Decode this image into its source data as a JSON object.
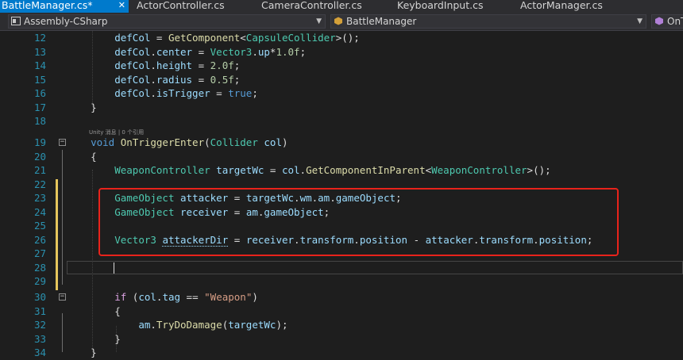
{
  "tabs": [
    {
      "label": "BattleManager.cs*",
      "close": "✕",
      "active": true
    },
    {
      "label": "ActorController.cs",
      "active": false
    },
    {
      "label": "CameraController.cs",
      "active": false
    },
    {
      "label": "KeyboardInput.cs",
      "active": false
    },
    {
      "label": "ActorManager.cs",
      "active": false
    }
  ],
  "navbar": {
    "project": "Assembly-CSharp",
    "class_name": "BattleManager",
    "member": "OnTrig"
  },
  "codelens": "Unity 消息 | 0 个引用",
  "line_numbers": [
    "12",
    "13",
    "14",
    "15",
    "16",
    "17",
    "18",
    "19",
    "20",
    "21",
    "22",
    "23",
    "24",
    "25",
    "26",
    "27",
    "28",
    "29",
    "30",
    "31",
    "32",
    "33",
    "34"
  ],
  "colors": {
    "editor_bg": "#1e1e1e",
    "active_tab": "#007acc",
    "highlight_box": "#e8231b",
    "change_bar": "#e6c65c"
  }
}
